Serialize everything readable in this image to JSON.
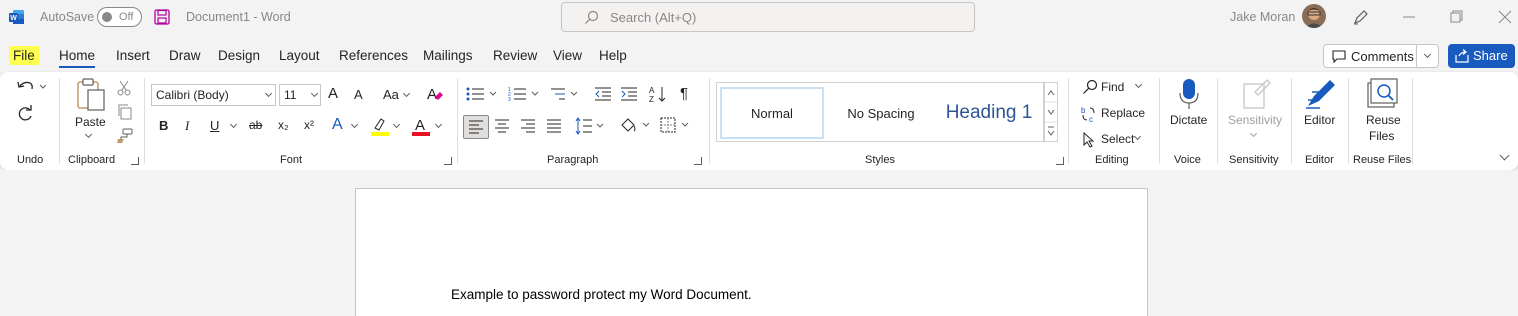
{
  "titlebar": {
    "autosave_label": "AutoSave",
    "autosave_state": "Off",
    "document_title": "Document1  -  Word",
    "search_placeholder": "Search (Alt+Q)",
    "user_name": "Jake Moran"
  },
  "tabs": [
    "File",
    "Home",
    "Insert",
    "Draw",
    "Design",
    "Layout",
    "References",
    "Mailings",
    "Review",
    "View",
    "Help"
  ],
  "active_tab": "Home",
  "header_actions": {
    "comments": "Comments",
    "share": "Share"
  },
  "ribbon": {
    "groups": {
      "undo": "Undo",
      "clipboard": "Clipboard",
      "font": "Font",
      "paragraph": "Paragraph",
      "styles": "Styles",
      "editing": "Editing",
      "voice": "Voice",
      "sensitivity": "Sensitivity",
      "editor": "Editor",
      "reuse_files": "Reuse Files"
    },
    "paste_label": "Paste",
    "font_name": "Calibri (Body)",
    "font_size": "11",
    "styles": [
      "Normal",
      "No Spacing",
      "Heading 1"
    ],
    "find_label": "Find",
    "replace_label": "Replace",
    "select_label": "Select",
    "dictate_label": "Dictate",
    "sensitivity_label": "Sensitivity",
    "editor_label": "Editor",
    "reuse_line1": "Reuse",
    "reuse_line2": "Files",
    "font_glyphs": {
      "bold": "B",
      "italic": "I",
      "underline": "U",
      "strike": "ab",
      "subscript": "x₂",
      "superscript": "x²",
      "grow": "A",
      "shrink": "A",
      "case": "Aa",
      "effects": "A",
      "highlight": "ab",
      "color": "A"
    }
  },
  "document": {
    "body_text": "Example to password protect my Word Document."
  },
  "colors": {
    "accent": "#185abd",
    "file_highlight": "#ffff4d",
    "heading": "#2f5496"
  }
}
